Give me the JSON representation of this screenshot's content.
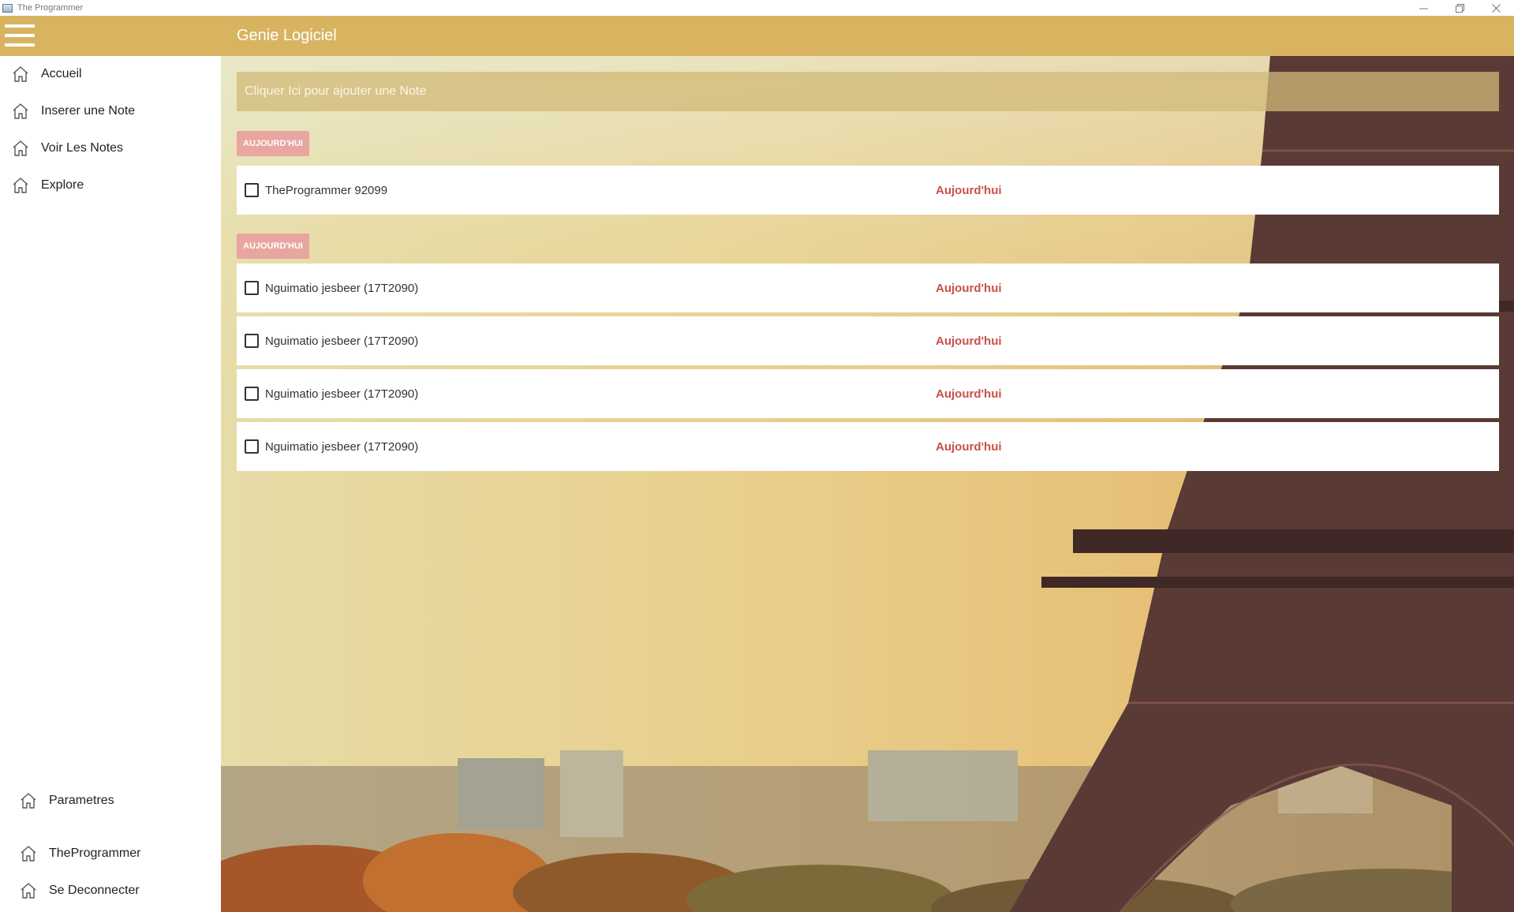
{
  "window": {
    "title": "The Programmer",
    "controls": [
      "minimize-icon",
      "restore-icon",
      "close-icon"
    ]
  },
  "header": {
    "title": "Genie Logiciel",
    "menu_icon": "hamburger-icon",
    "bg_color": "#d8b461"
  },
  "sidebar": {
    "items": [
      {
        "label": "Accueil",
        "icon": "home-icon"
      },
      {
        "label": "Inserer une Note",
        "icon": "home-icon"
      },
      {
        "label": "Voir Les Notes",
        "icon": "home-icon"
      },
      {
        "label": "Explore",
        "icon": "home-icon"
      }
    ],
    "bottom_items": [
      {
        "label": "Parametres",
        "icon": "home-icon"
      },
      {
        "label": "TheProgrammer",
        "icon": "home-icon"
      },
      {
        "label": "Se Deconnecter",
        "icon": "home-icon"
      }
    ]
  },
  "main": {
    "add_note_placeholder": "Cliquer Ici pour ajouter une Note",
    "groups": [
      {
        "badge": "AUJOURD'HUI",
        "notes": [
          {
            "text": "TheProgrammer 92099",
            "date": "Aujourd'hui",
            "checked": false
          }
        ]
      },
      {
        "badge": "AUJOURD'HUI",
        "notes": [
          {
            "text": "Nguimatio jesbeer  (17T2090)",
            "date": "Aujourd'hui",
            "checked": false
          },
          {
            "text": "Nguimatio jesbeer  (17T2090)",
            "date": "Aujourd'hui",
            "checked": false
          },
          {
            "text": "Nguimatio jesbeer  (17T2090)",
            "date": "Aujourd'hui",
            "checked": false
          },
          {
            "text": "Nguimatio jesbeer  (17T2090)",
            "date": "Aujourd'hui",
            "checked": false
          }
        ]
      }
    ],
    "colors": {
      "badge_bg": "#e8a6a0",
      "date_text": "#c8504a"
    }
  }
}
